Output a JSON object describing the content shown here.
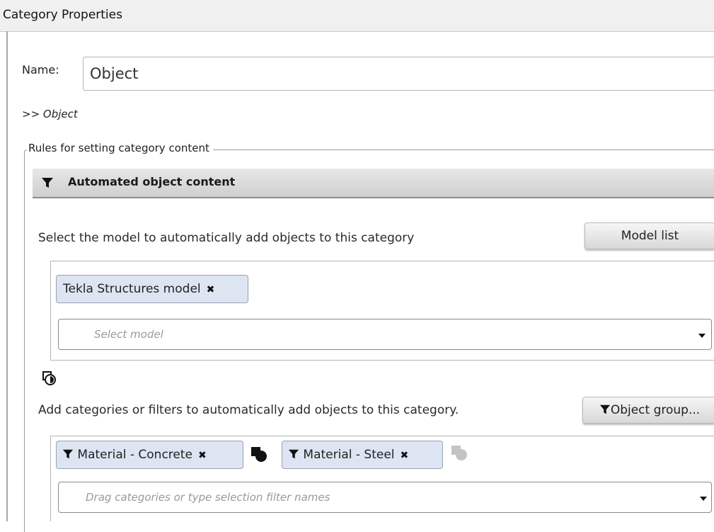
{
  "window": {
    "title": "Category Properties"
  },
  "name_field": {
    "label": "Name:",
    "value": "Object"
  },
  "breadcrumb": {
    "prefix": ">>",
    "current": "Object"
  },
  "rules_group": {
    "title": "Rules for setting category content",
    "section_header": "Automated object content",
    "model": {
      "instruction": "Select the model to automatically add objects to this category",
      "button_label": "Model list",
      "chips": [
        {
          "label": "Tekla Structures model"
        }
      ],
      "select_placeholder": "Select model"
    },
    "filters": {
      "instruction": "Add categories or filters to automatically add objects to this category.",
      "button_label": "Object group...",
      "chips": [
        {
          "label": "Material - Concrete"
        },
        {
          "label": "Material - Steel"
        }
      ],
      "select_placeholder": "Drag categories or type selection filter names"
    }
  },
  "colors": {
    "chip_bg": "#dde4f2",
    "header_bg": "#d8d8d8",
    "border": "#b4b4b4"
  },
  "icons": [
    "filter-icon",
    "close-icon",
    "dropdown-caret-icon",
    "combine-icon"
  ]
}
